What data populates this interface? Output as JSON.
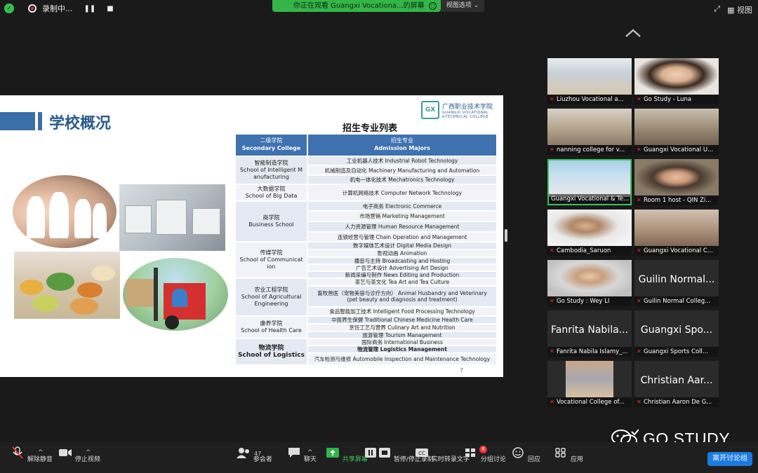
{
  "topbar": {
    "recording_label": "录制中...",
    "pause_icon": "pause-icon",
    "stop_icon": "stop-icon",
    "banner_text": "你正在观看 Guangxi Vocationa...的屏幕",
    "view_options": "视图选项 ⌄",
    "view_label": "视图"
  },
  "slide": {
    "title": "学校概况",
    "logo_cn": "广西职业技术学院",
    "logo_en_1": "GUANGXI VOCATIONAL",
    "logo_en_2": "&TECHNICAL COLLEGE",
    "table_title": "招生专业列表",
    "header": {
      "col1_cn": "二级学院",
      "col1_en": "Secondary College",
      "col2_cn": "招生专业",
      "col2_en": "Admission Majors"
    },
    "schools": [
      {
        "cn": "智能制造学院",
        "en": "School of Intelligent M anufacturing"
      },
      {
        "cn": "大数据学院",
        "en": "School of Big Data"
      },
      {
        "cn": "商学院",
        "en": "Business School"
      },
      {
        "cn": "传媒学院",
        "en": "School of Communicat ion"
      },
      {
        "cn": "农业工程学院",
        "en": "School of Agricultural Engineering"
      },
      {
        "cn": "康养学院",
        "en": "School of Health Care"
      },
      {
        "cn": "物流学院",
        "en": "School of Logistics"
      }
    ],
    "majors": [
      "工业机器人技术 Industrial Robot Technology",
      "机械制造及自动化 Machinery Manufacturing and Automation",
      "机电一体化技术 Mechatronics Technology",
      "计算机网络技术 Computer Network Technology",
      "电子商务 Electronic Commerce",
      "市场营销 Marketing Management",
      "人力资源管理 Human Resource Management",
      "连锁经营与管理 Chain Operation and Management",
      "数字媒体艺术设计 Digital Media Design",
      "影视动画 Animation",
      "播音与主持 Broadcasting and Hosting",
      "广告艺术设计 Advertising Art Design",
      "新闻采编与制作 News Editing and Production",
      "茶艺与茶文化 Tea Art and Tea Culture",
      "畜牧兽医（宠物美容与诊疗方向） Animal Husbandry and Veterinary (pet beauty and diagnosis and treatment)",
      "食品智能加工技术 Intelligent Food Processing Technology",
      "中医养生保健 Traditional Chinese Medicine Health Care",
      "烹饪工艺与营养 Culinary Art and Nutrition",
      "旅游管理 Tourism Management",
      "国际商务 International Business",
      "物流管理 Logistics Management",
      "汽车检测与维修 Automobile Inspection and Maintenance Technology"
    ],
    "page_number": "7"
  },
  "gallery": [
    {
      "label": "Liuzhou Vocational a...",
      "type": "video"
    },
    {
      "label": "Go Study - Luna",
      "type": "video"
    },
    {
      "label": "nanning college for v...",
      "type": "video"
    },
    {
      "label": "Guangxi Vocational U...",
      "type": "video"
    },
    {
      "label": "Guangxi Vocational & Te...",
      "type": "video",
      "active": true
    },
    {
      "label": "Room 1 host - QIN Zi...",
      "type": "video"
    },
    {
      "label": "Cambodia_Saruon",
      "type": "video"
    },
    {
      "label": "Guangxi Vocational C...",
      "type": "video"
    },
    {
      "label": "Go Study : Wey LI",
      "type": "video"
    },
    {
      "label": "Guilin Normal Colleg...",
      "type": "name",
      "big": "Guilin Normal..."
    },
    {
      "label": "Fanrita Nabila Islamy_...",
      "type": "name",
      "big": "Fanrita Nabila..."
    },
    {
      "label": "Guangxi Sports Coll...",
      "type": "name",
      "big": "Guangxi Spo..."
    },
    {
      "label": "Vocational College of...",
      "type": "video"
    },
    {
      "label": "Christian Aaron De G...",
      "type": "name",
      "big": "Christian Aar..."
    }
  ],
  "watermark": "GO STUDY",
  "toolbar": {
    "unmute": "解除静音",
    "stop_video": "停止视频",
    "participants": "参会者",
    "participants_count": "47",
    "chat": "聊天",
    "share": "共享屏幕",
    "pause_record": "暂停/停止录制",
    "transcript": "实时转录文字",
    "breakout": "分组讨论",
    "breakout_badge": "6",
    "reactions": "回应",
    "apps": "应用",
    "leave": "离开讨论组"
  },
  "colors": {
    "accent_green": "#35b548",
    "slide_blue": "#3f72b0",
    "leave_blue": "#1a7be0"
  }
}
